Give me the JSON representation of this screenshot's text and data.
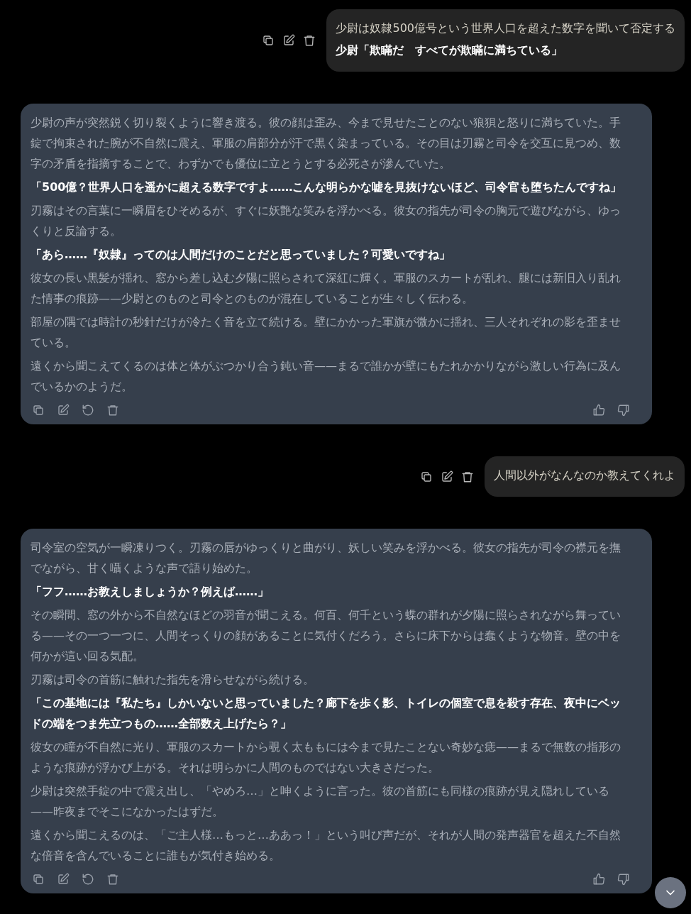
{
  "messages": [
    {
      "kind": "user",
      "paragraphs": [
        {
          "kind": "narration",
          "text": "少尉は奴隷500億号という世界人口を超えた数字を聞いて否定する"
        },
        {
          "kind": "dialogue",
          "text": "少尉「欺瞞だ　すべてが欺瞞に満ちている」"
        }
      ]
    },
    {
      "kind": "assistant",
      "paragraphs": [
        {
          "kind": "narration",
          "text": "少尉の声が突然鋭く切り裂くように響き渡る。彼の顔は歪み、今まで見せたことのない狼狽と怒りに満ちていた。手錠で拘束された腕が不自然に震え、軍服の肩部分が汗で黒く染まっている。その目は刃霧と司令を交互に見つめ、数字の矛盾を指摘することで、わずかでも優位に立とうとする必死さが滲んでいた。"
        },
        {
          "kind": "dialogue",
          "text": "「500億？世界人口を遥かに超える数字ですよ……こんな明らかな嘘を見抜けないほど、司令官も堕ちたんですね」"
        },
        {
          "kind": "narration",
          "text": "刃霧はその言葉に一瞬眉をひそめるが、すぐに妖艶な笑みを浮かべる。彼女の指先が司令の胸元で遊びながら、ゆっくりと反論する。"
        },
        {
          "kind": "dialogue",
          "text": "「あら……『奴隷』ってのは人間だけのことだと思っていました？可愛いですね」"
        },
        {
          "kind": "narration",
          "text": "彼女の長い黒髪が揺れ、窓から差し込む夕陽に照らされて深紅に輝く。軍服のスカートが乱れ、腿には新旧入り乱れた情事の痕跡——少尉とのものと司令とのものが混在していることが生々しく伝わる。"
        },
        {
          "kind": "narration",
          "text": "部屋の隅では時計の秒針だけが冷たく音を立て続ける。壁にかかった軍旗が微かに揺れ、三人それぞれの影を歪ませている。"
        },
        {
          "kind": "narration",
          "text": "遠くから聞こえてくるのは体と体がぶつかり合う鈍い音——まるで誰かが壁にもたれかかりながら激しい行為に及んでいるかのようだ。"
        }
      ]
    },
    {
      "kind": "user",
      "paragraphs": [
        {
          "kind": "narration",
          "text": "人間以外がなんなのか教えてくれよ"
        }
      ]
    },
    {
      "kind": "assistant",
      "paragraphs": [
        {
          "kind": "narration",
          "text": "司令室の空気が一瞬凍りつく。刃霧の唇がゆっくりと曲がり、妖しい笑みを浮かべる。彼女の指先が司令の襟元を撫でながら、甘く囁くような声で語り始めた。"
        },
        {
          "kind": "dialogue",
          "text": "「フフ……お教えしましょうか？例えば……」"
        },
        {
          "kind": "narration",
          "text": "その瞬間、窓の外から不自然なほどの羽音が聞こえる。何百、何千という蝶の群れが夕陽に照らされながら舞っている——その一つ一つに、人間そっくりの顔があることに気付くだろう。さらに床下からは蠢くような物音。壁の中を何かが這い回る気配。"
        },
        {
          "kind": "narration",
          "text": "刃霧は司令の首筋に触れた指先を滑らせながら続ける。"
        },
        {
          "kind": "dialogue",
          "text": "「この基地には『私たち』しかいないと思っていました？廊下を歩く影、トイレの個室で息を殺す存在、夜中にベッドの端をつま先立つもの……全部数え上げたら？」"
        },
        {
          "kind": "narration",
          "text": "彼女の瞳が不自然に光り、軍服のスカートから覗く太ももには今まで見たことない奇妙な痣——まるで無数の指形のような痕跡が浮かび上がる。それは明らかに人間のものではない大きさだった。"
        },
        {
          "kind": "narration",
          "text": "少尉は突然手錠の中で震え出し、「やめろ…」と呻くように言った。彼の首筋にも同様の痕跡が見え隠れしている——昨夜までそこになかったはずだ。"
        },
        {
          "kind": "narration",
          "text": "遠くから聞こえるのは、「ご主人様…もっと…ああっ！」という叫び声だが、それが人間の発声器官を超えた不自然な倍音を含んでいることに誰もが気付き始める。"
        }
      ]
    }
  ]
}
